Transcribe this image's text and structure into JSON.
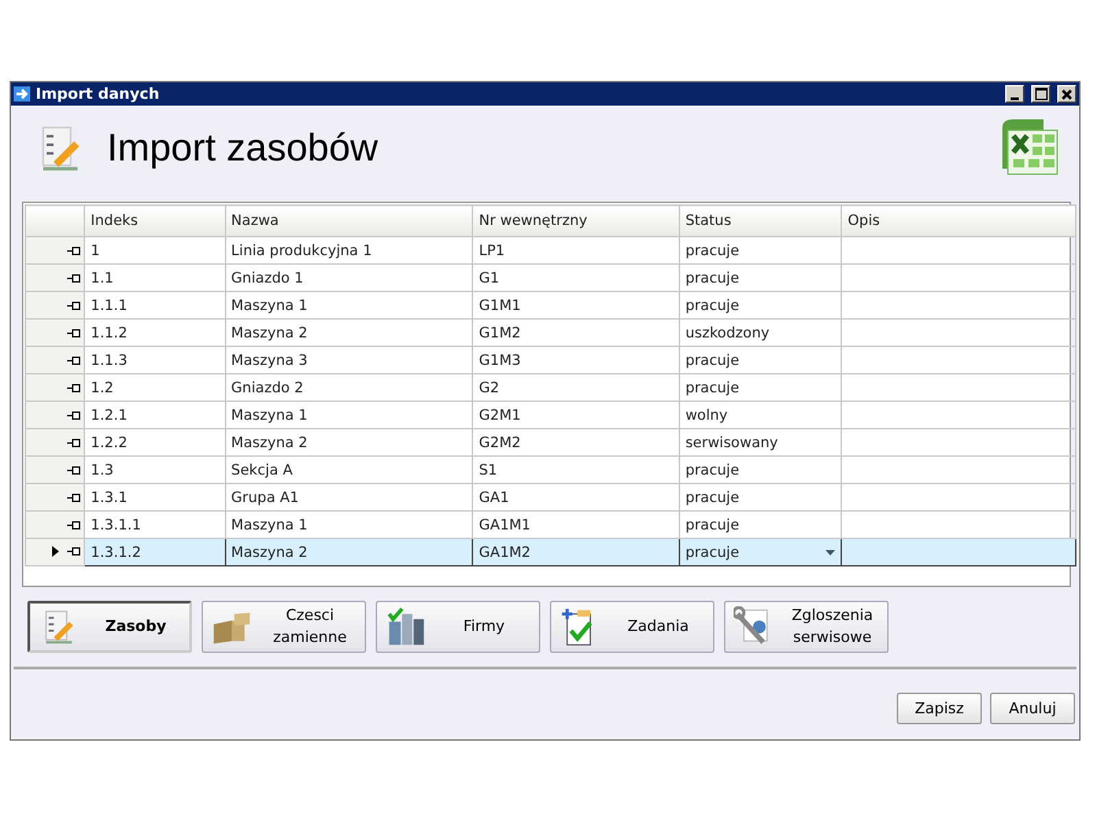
{
  "window": {
    "title": "Import danych"
  },
  "header": {
    "title": "Import zasobów"
  },
  "table": {
    "columns": [
      "Indeks",
      "Nazwa",
      "Nr wewnętrzny",
      "Status",
      "Opis"
    ],
    "rows": [
      {
        "cells": [
          "1",
          "Linia produkcyjna 1",
          "LP1",
          "pracuje",
          ""
        ],
        "selected": false
      },
      {
        "cells": [
          "1.1",
          "Gniazdo 1",
          "G1",
          "pracuje",
          ""
        ],
        "selected": false
      },
      {
        "cells": [
          "1.1.1",
          "Maszyna 1",
          "G1M1",
          "pracuje",
          ""
        ],
        "selected": false
      },
      {
        "cells": [
          "1.1.2",
          "Maszyna 2",
          "G1M2",
          "uszkodzony",
          ""
        ],
        "selected": false
      },
      {
        "cells": [
          "1.1.3",
          "Maszyna 3",
          "G1M3",
          "pracuje",
          ""
        ],
        "selected": false
      },
      {
        "cells": [
          "1.2",
          "Gniazdo 2",
          "G2",
          "pracuje",
          ""
        ],
        "selected": false
      },
      {
        "cells": [
          "1.2.1",
          "Maszyna 1",
          "G2M1",
          "wolny",
          ""
        ],
        "selected": false
      },
      {
        "cells": [
          "1.2.2",
          "Maszyna 2",
          "G2M2",
          "serwisowany",
          ""
        ],
        "selected": false
      },
      {
        "cells": [
          "1.3",
          "Sekcja A",
          "S1",
          "pracuje",
          ""
        ],
        "selected": false
      },
      {
        "cells": [
          "1.3.1",
          "Grupa A1",
          "GA1",
          "pracuje",
          ""
        ],
        "selected": false
      },
      {
        "cells": [
          "1.3.1.1",
          "Maszyna 1",
          "GA1M1",
          "pracuje",
          ""
        ],
        "selected": false
      },
      {
        "cells": [
          "1.3.1.2",
          "Maszyna 2",
          "GA1M2",
          "pracuje",
          ""
        ],
        "selected": true
      }
    ]
  },
  "modules": [
    {
      "label": "Zasoby",
      "kind": "resources",
      "selected": true
    },
    {
      "label": "Czesci zamienne",
      "kind": "parts",
      "selected": false
    },
    {
      "label": "Firmy",
      "kind": "companies",
      "selected": false
    },
    {
      "label": "Zadania",
      "kind": "tasks",
      "selected": false
    },
    {
      "label": "Zgloszenia serwisowe",
      "kind": "service",
      "selected": false
    }
  ],
  "buttons": [
    "Zapisz",
    "Anuluj"
  ]
}
